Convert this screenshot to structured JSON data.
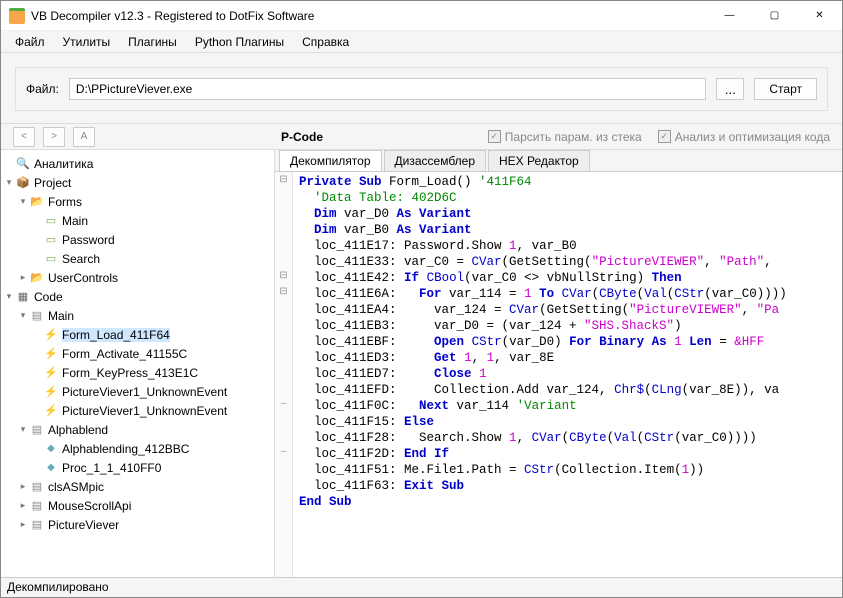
{
  "window": {
    "title": "VB Decompiler v12.3 - Registered to DotFix Software"
  },
  "menu": {
    "items": [
      "Файл",
      "Утилиты",
      "Плагины",
      "Python Плагины",
      "Справка"
    ]
  },
  "file": {
    "label": "Файл:",
    "path": "D:\\PPictureViever.exe",
    "browse": "...",
    "start": "Старт"
  },
  "nav": {
    "back": "<",
    "fwd": ">",
    "a": "A",
    "mode": "P-Code",
    "chk_parse": "Парсить парам. из стека",
    "chk_opt": "Анализ и оптимизация кода"
  },
  "tree": {
    "analytics": "Аналитика",
    "project": "Project",
    "forms": "Forms",
    "form_main": "Main",
    "form_password": "Password",
    "form_search": "Search",
    "usercontrols": "UserControls",
    "code": "Code",
    "code_main": "Main",
    "fn_form_load": "Form_Load_411F64",
    "fn_form_activate": "Form_Activate_41155C",
    "fn_form_keypress": "Form_KeyPress_413E1C",
    "fn_pv1a": "PictureViever1_UnknownEvent",
    "fn_pv1b": "PictureViever1_UnknownEvent",
    "alphablend": "Alphablend",
    "fn_alpha": "Alphablending_412BBC",
    "fn_proc": "Proc_1_1_410FF0",
    "cls_asm": "clsASMpic",
    "mouse": "MouseScrollApi",
    "pv": "PictureViever"
  },
  "tabs": {
    "t0": "Декомпилятор",
    "t1": "Дизассемблер",
    "t2": "HEX Редактор"
  },
  "code_lines": [
    {
      "g": "⊟",
      "html": "<span class='kw'>Private Sub</span> Form_Load() <span class='cm'>'411F64</span>"
    },
    {
      "g": "",
      "html": "  <span class='cm'>'Data Table: 402D6C</span>"
    },
    {
      "g": "",
      "html": "  <span class='kw'>Dim</span> var_D0 <span class='kw'>As Variant</span>"
    },
    {
      "g": "",
      "html": "  <span class='kw'>Dim</span> var_B0 <span class='kw'>As Variant</span>"
    },
    {
      "g": "",
      "html": "  loc_411E17: Password.Show <span class='nu'>1</span>, var_B0"
    },
    {
      "g": "",
      "html": "  loc_411E33: var_C0 = <span class='fn'>CVar</span>(GetSetting(<span class='st'>\"PictureVIEWER\"</span>, <span class='st'>\"Path\"</span>,"
    },
    {
      "g": "⊟",
      "html": "  loc_411E42: <span class='kw'>If</span> <span class='fn'>CBool</span>(var_C0 &lt;&gt; vbNullString) <span class='kw'>Then</span>"
    },
    {
      "g": "⊟",
      "html": "  loc_411E6A:   <span class='kw'>For</span> var_114 = <span class='nu'>1</span> <span class='kw'>To</span> <span class='fn'>CVar</span>(<span class='fn'>CByte</span>(<span class='fn'>Val</span>(<span class='fn'>CStr</span>(var_C0))))"
    },
    {
      "g": "",
      "html": "  loc_411EA4:     var_124 = <span class='fn'>CVar</span>(GetSetting(<span class='st'>\"PictureVIEWER\"</span>, <span class='st'>\"Pa</span>"
    },
    {
      "g": "",
      "html": "  loc_411EB3:     var_D0 = (var_124 + <span class='st'>\"SHS.ShackS\"</span>)"
    },
    {
      "g": "",
      "html": "  loc_411EBF:     <span class='kw'>Open</span> <span class='fn'>CStr</span>(var_D0) <span class='kw'>For Binary As</span> <span class='nu'>1</span> <span class='kw'>Len</span> = <span class='nu'>&amp;HFF</span>"
    },
    {
      "g": "",
      "html": "  loc_411ED3:     <span class='kw'>Get</span> <span class='nu'>1</span>, <span class='nu'>1</span>, var_8E"
    },
    {
      "g": "",
      "html": "  loc_411ED7:     <span class='kw'>Close</span> <span class='nu'>1</span>"
    },
    {
      "g": "",
      "html": "  loc_411EFD:     Collection.Add var_124, <span class='fn'>Chr$</span>(<span class='fn'>CLng</span>(var_8E)), va"
    },
    {
      "g": "–",
      "html": "  loc_411F0C:   <span class='kw'>Next</span> var_114 <span class='cm'>'Variant</span>"
    },
    {
      "g": "",
      "html": "  loc_411F15: <span class='kw'>Else</span>"
    },
    {
      "g": "",
      "html": "  loc_411F28:   Search.Show <span class='nu'>1</span>, <span class='fn'>CVar</span>(<span class='fn'>CByte</span>(<span class='fn'>Val</span>(<span class='fn'>CStr</span>(var_C0))))"
    },
    {
      "g": "–",
      "html": "  loc_411F2D: <span class='kw'>End If</span>"
    },
    {
      "g": "",
      "html": "  loc_411F51: Me.File1.Path = <span class='fn'>CStr</span>(Collection.Item(<span class='nu'>1</span>))"
    },
    {
      "g": "",
      "html": "  loc_411F63: <span class='kw'>Exit Sub</span>"
    },
    {
      "g": "",
      "html": "<span class='kw'>End Sub</span>"
    }
  ],
  "status": "Декомпилировано"
}
